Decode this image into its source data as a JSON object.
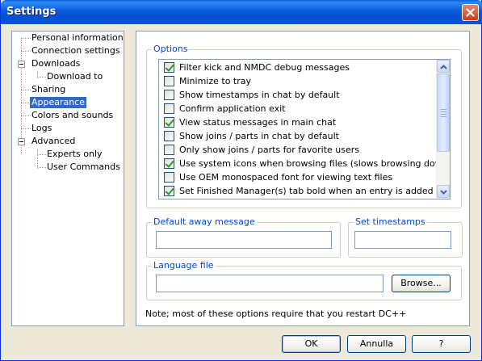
{
  "window": {
    "title": "Settings"
  },
  "icons": {
    "close": "close-x-icon",
    "scroll_up": "scroll-up-arrow-icon",
    "scroll_down": "scroll-down-arrow-icon"
  },
  "tree": {
    "items": [
      {
        "label": "Personal information",
        "level": 0,
        "selected": false
      },
      {
        "label": "Connection settings",
        "level": 0,
        "selected": false
      },
      {
        "label": "Downloads",
        "level": 0,
        "selected": false,
        "expanded": true
      },
      {
        "label": "Download to",
        "level": 1,
        "selected": false
      },
      {
        "label": "Sharing",
        "level": 0,
        "selected": false
      },
      {
        "label": "Appearance",
        "level": 0,
        "selected": true
      },
      {
        "label": "Colors and sounds",
        "level": 0,
        "selected": false
      },
      {
        "label": "Logs",
        "level": 0,
        "selected": false
      },
      {
        "label": "Advanced",
        "level": 0,
        "selected": false,
        "expanded": true
      },
      {
        "label": "Experts only",
        "level": 1,
        "selected": false
      },
      {
        "label": "User Commands",
        "level": 1,
        "selected": false
      }
    ]
  },
  "options": {
    "group_label": "Options",
    "items": [
      {
        "label": "Filter kick and NMDC debug messages",
        "checked": true
      },
      {
        "label": "Minimize to tray",
        "checked": false
      },
      {
        "label": "Show timestamps in chat by default",
        "checked": false
      },
      {
        "label": "Confirm application exit",
        "checked": false
      },
      {
        "label": "View status messages in main chat",
        "checked": true
      },
      {
        "label": "Show joins / parts in chat by default",
        "checked": false
      },
      {
        "label": "Only show joins / parts for favorite users",
        "checked": false
      },
      {
        "label": "Use system icons when browsing files (slows browsing down a bit)",
        "checked": true
      },
      {
        "label": "Use OEM monospaced font for viewing text files",
        "checked": false
      },
      {
        "label": "Set Finished Manager(s) tab bold when an entry is added",
        "checked": true
      }
    ]
  },
  "away": {
    "group_label": "Default away message",
    "value": ""
  },
  "timestamps": {
    "group_label": "Set timestamps",
    "value": ""
  },
  "language": {
    "group_label": "Language file",
    "value": "",
    "browse_label": "Browse..."
  },
  "note": "Note; most of these options require that you restart DC++",
  "buttons": {
    "ok": "OK",
    "cancel": "Annulla",
    "help": "?"
  }
}
